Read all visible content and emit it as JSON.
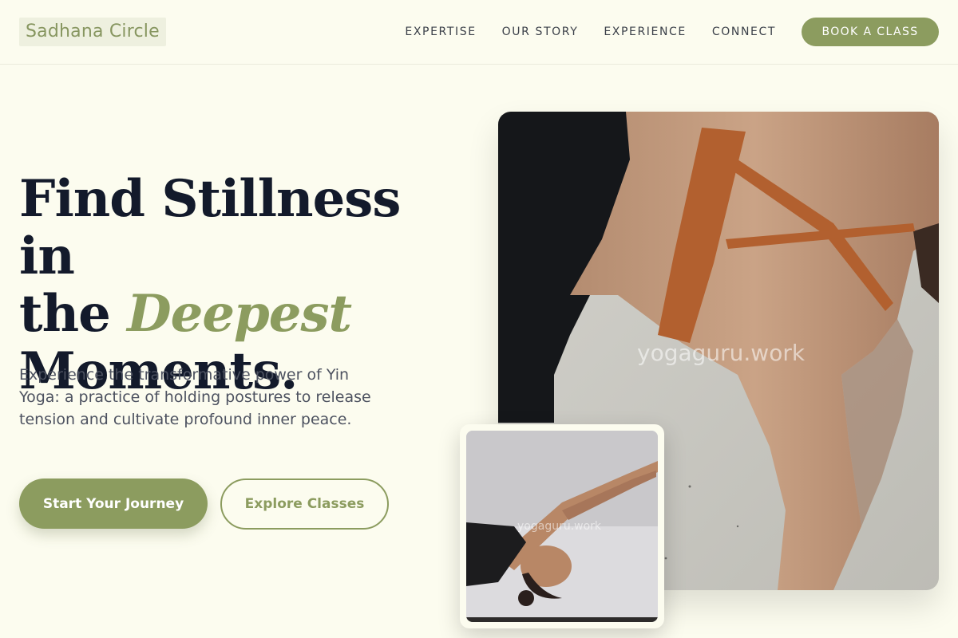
{
  "brand": {
    "name": "Sadhana Circle",
    "accent_color": "#8c9c5f",
    "background": "#fcfcef"
  },
  "nav": {
    "links": [
      "EXPERTISE",
      "OUR STORY",
      "EXPERIENCE",
      "CONNECT"
    ],
    "cta_label": "BOOK A CLASS"
  },
  "hero": {
    "title_line1": "Find Stillness in",
    "title_line2_prefix": "the ",
    "title_accent": "Deepest",
    "title_line3": "Moments.",
    "description": "Experience the transformative power of Yin Yoga: a practice of holding postures to release tension and cultivate profound inner peace.",
    "primary_cta": "Start Your Journey",
    "secondary_cta": "Explore Classes"
  },
  "images": {
    "main_watermark": "yogaguru.work",
    "small_watermark": "yogaguru.work"
  }
}
